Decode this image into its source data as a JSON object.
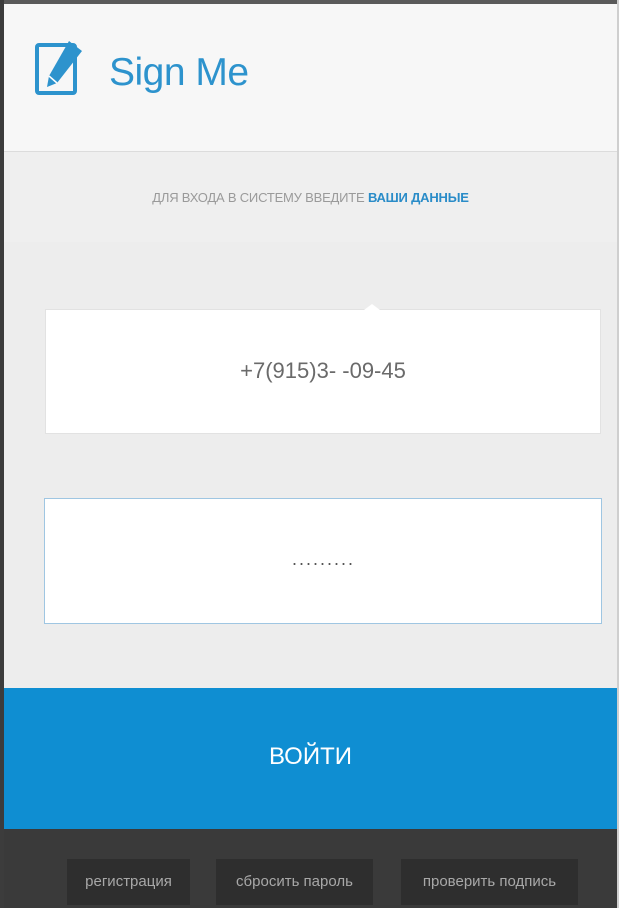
{
  "header": {
    "title": "Sign Me",
    "logo_icon": "pen-on-page-icon",
    "accent_color": "#2d93cd"
  },
  "subtitle": {
    "prefix": "ДЛЯ ВХОДА В СИСТЕМУ ВВЕДИТЕ",
    "accent": "ВАШИ ДАННЫЕ"
  },
  "form": {
    "phone_value": "+7(915)3-   -09-45",
    "password_mask": "·········"
  },
  "login_button": {
    "label": "ВОЙТИ",
    "color": "#0f8ed2"
  },
  "footer": {
    "links": [
      {
        "label": "регистрация"
      },
      {
        "label": "сбросить пароль"
      },
      {
        "label": "проверить подпись"
      }
    ]
  }
}
